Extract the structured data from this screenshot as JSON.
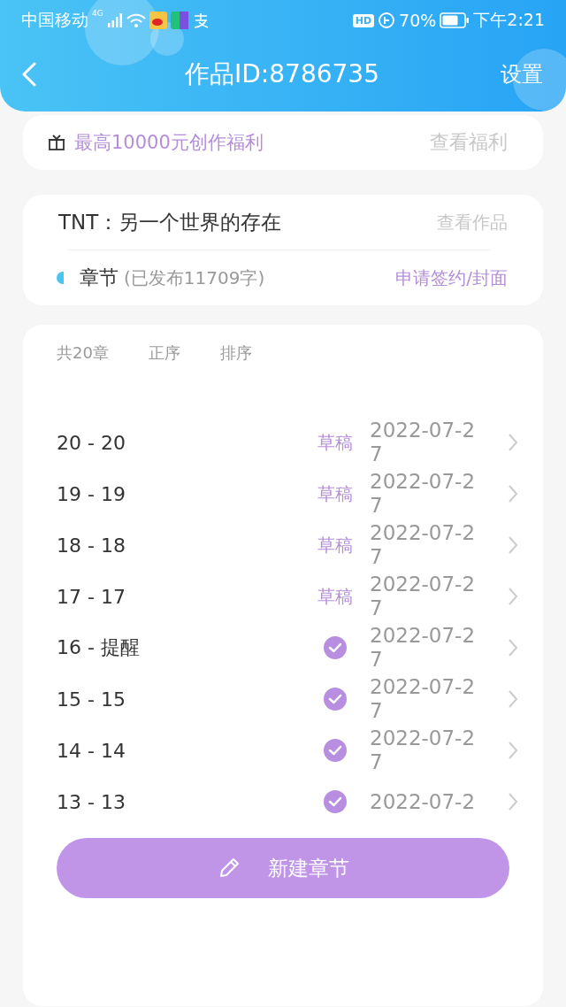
{
  "status_bar": {
    "carrier": "中国移动",
    "network": "4G",
    "hd": "HD",
    "battery": "70%",
    "time": "下午2:21"
  },
  "header": {
    "title": "作品ID:8786735",
    "action": "设置"
  },
  "benefit": {
    "text": "最高10000元创作福利",
    "link": "查看福利"
  },
  "work": {
    "title": "TNT：另一个世界的存在",
    "link": "查看作品",
    "section": "章节",
    "published": "(已发布11709字)",
    "apply": "申请签约/封面"
  },
  "chapters": {
    "count": "共20章",
    "sort_asc": "正序",
    "sort": "排序",
    "rows": [
      {
        "title": "20 - 20",
        "kind": "draft",
        "status": "草稿",
        "date": "2022-07-27"
      },
      {
        "title": "19 - 19",
        "kind": "draft",
        "status": "草稿",
        "date": "2022-07-27"
      },
      {
        "title": "18 - 18",
        "kind": "draft",
        "status": "草稿",
        "date": "2022-07-27"
      },
      {
        "title": "17 - 17",
        "kind": "draft",
        "status": "草稿",
        "date": "2022-07-27"
      },
      {
        "title": "16 - 提醒",
        "kind": "published",
        "date": "2022-07-27"
      },
      {
        "title": "15 - 15",
        "kind": "published",
        "date": "2022-07-27"
      },
      {
        "title": "14 - 14",
        "kind": "published",
        "date": "2022-07-27"
      },
      {
        "title": "13 - 13",
        "kind": "published",
        "date": "2022-07-2"
      }
    ]
  },
  "new_button": "新建章节"
}
